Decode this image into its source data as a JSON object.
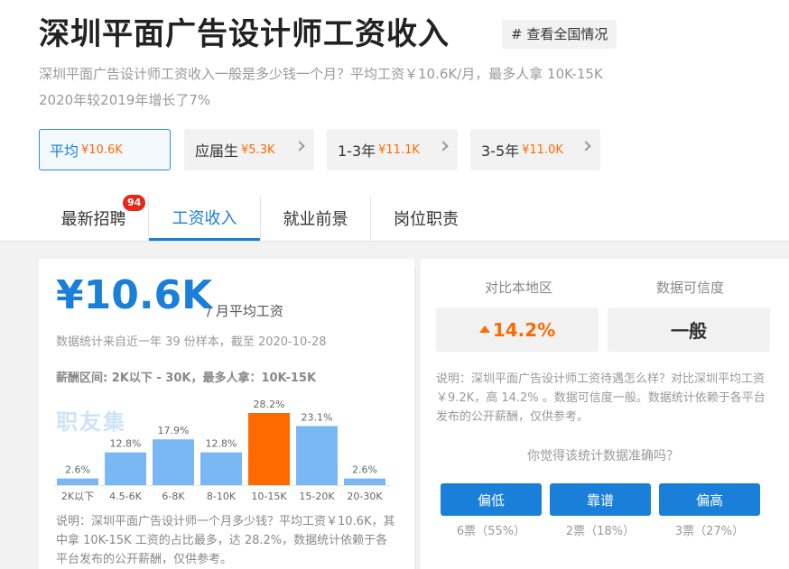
{
  "header": {
    "title": "深圳平面广告设计师工资收入",
    "national_tag": "# 查看全国情况",
    "description_line1": "深圳平面广告设计师工资收入一般是多少钱一个月？平均工资￥10.6K/月，最多人拿 10K-15K",
    "description_line2": "2020年较2019年增长了7%"
  },
  "pills": [
    {
      "label": "平均",
      "value": "¥10.6K"
    },
    {
      "label": "应届生",
      "value": "¥5.3K"
    },
    {
      "label": "1-3年",
      "value": "¥11.1K"
    },
    {
      "label": "3-5年",
      "value": "¥11.0K"
    }
  ],
  "tabs": [
    {
      "label": "最新招聘",
      "badge": "94"
    },
    {
      "label": "工资收入"
    },
    {
      "label": "就业前景"
    },
    {
      "label": "岗位职责"
    }
  ],
  "left": {
    "avg_value": "¥10.6K",
    "avg_unit": "/ 月平均工资",
    "stat_note": "数据统计来自近一年 39 份样本，截至 2020-10-28",
    "range_line": "薪酬区间: 2K以下 - 30K，最多人拿：10K-15K",
    "watermark": "职友集",
    "description": "说明：深圳平面广告设计师一个月多少钱？平均工资￥10.6K，其中拿 10K-15K 工资的占比最多，达 28.2%，数据统计依赖于各平台发布的公开薪酬，仅供参考。"
  },
  "chart_data": {
    "type": "bar",
    "categories": [
      "2K以下",
      "4.5-6K",
      "6-8K",
      "8-10K",
      "10-15K",
      "15-20K",
      "20-30K"
    ],
    "values": [
      2.6,
      12.8,
      17.9,
      12.8,
      28.2,
      23.1,
      2.6
    ],
    "value_labels": [
      "2.6%",
      "12.8%",
      "17.9%",
      "12.8%",
      "28.2%",
      "23.1%",
      "2.6%"
    ],
    "highlight_index": 4,
    "colors": {
      "normal": "#79b8f5",
      "highlight": "#ff6a00"
    },
    "ylim": [
      0,
      28.2
    ]
  },
  "right": {
    "compare_region_label": "对比本地区",
    "compare_region_value": "14.2%",
    "credibility_label": "数据可信度",
    "credibility_value": "一般",
    "description": "说明：深圳平面广告设计师工资待遇怎么样？对比深圳平均工资 ￥9.2K，高 14.2% 。数据可信度一般。数据统计依赖于各平台发布的公开薪酬，仅供参考。",
    "question": "你觉得该统计数据准确吗？",
    "votes": [
      {
        "label": "偏低",
        "count": "6票（55%）"
      },
      {
        "label": "靠谱",
        "count": "2票（18%）"
      },
      {
        "label": "偏高",
        "count": "3票（27%）"
      }
    ]
  },
  "colors": {
    "accent": "#1a7fd8",
    "highlight": "#ff6a00",
    "badge": "#e8271b"
  }
}
